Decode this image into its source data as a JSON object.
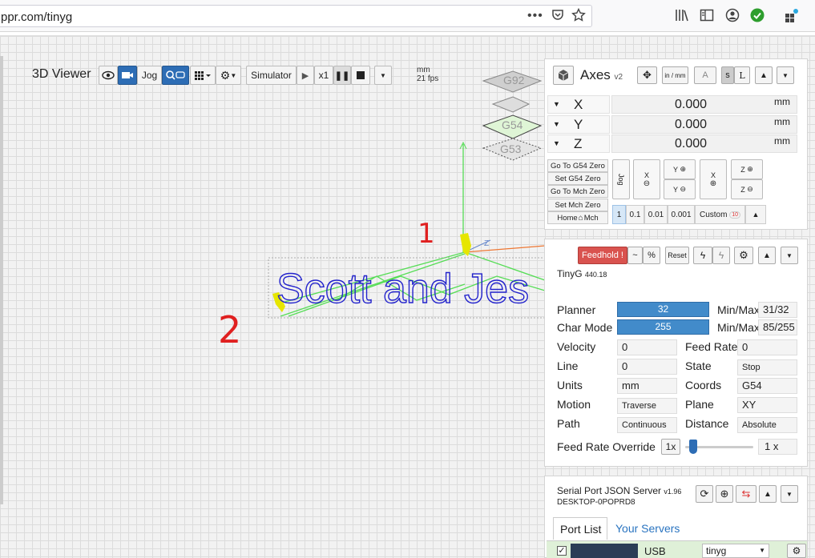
{
  "browser": {
    "url": "ppr.com/tinyg",
    "page_actions_icon": "ellipsis-icon",
    "pocket_icon": "pocket-icon",
    "bookmark_icon": "star-icon",
    "library_icon": "library-icon",
    "reader_icon": "sidebar-icon",
    "account_icon": "account-icon",
    "status_icon": "checkmark-icon",
    "extensions_icon": "extensions-icon"
  },
  "viewer": {
    "title": "3D Viewer",
    "jog_label": "Jog",
    "simulator_label": "Simulator",
    "speed_label": "x1",
    "units": "mm",
    "fps": "21 fps",
    "workspaces": [
      "G92",
      "G54",
      "G53"
    ],
    "canvas_text": "Scott and Jes",
    "annotation_1": "1",
    "annotation_2": "2"
  },
  "axes": {
    "title": "Axes",
    "version": "v2",
    "inmm_label": "in / mm",
    "s_label": "s",
    "l_label": "L",
    "rows": [
      {
        "name": "X",
        "value": "0.000",
        "unit": "mm"
      },
      {
        "name": "Y",
        "value": "0.000",
        "unit": "mm"
      },
      {
        "name": "Z",
        "value": "0.000",
        "unit": "mm"
      }
    ],
    "zero_buttons": [
      "Go To G54 Zero",
      "Set G54 Zero",
      "Go To Mch Zero",
      "Set Mch Zero",
      "Mch"
    ],
    "home_label": "Home",
    "jog_label": "Jog",
    "jog_x_minus": "X",
    "jog_x_plus": "X",
    "jog_y_plus": "Y",
    "jog_y_minus": "Y",
    "jog_z_plus": "Z",
    "jog_z_minus": "Z",
    "steps": [
      "1",
      "0.1",
      "0.01",
      "0.001"
    ],
    "custom_label": "Custom",
    "custom_value": "10"
  },
  "tinyg": {
    "feedhold_label": "Feedhold !",
    "tilde_label": "~",
    "percent_label": "%",
    "reset_label": "Reset",
    "name": "TinyG",
    "version": "440.18",
    "planner_label": "Planner",
    "planner_value": "32",
    "planner_fill": 1.0,
    "minmax_label": "Min/Max",
    "planner_minmax": "31/32",
    "charmode_label": "Char Mode",
    "charmode_value": "255",
    "charmode_fill": 1.0,
    "charmode_minmax": "85/255",
    "fields_left": [
      {
        "label": "Velocity",
        "value": "0"
      },
      {
        "label": "Line",
        "value": "0"
      },
      {
        "label": "Units",
        "value": "mm"
      },
      {
        "label": "Motion",
        "value": "Traverse"
      },
      {
        "label": "Path",
        "value": "Continuous"
      }
    ],
    "fields_right": [
      {
        "label": "Feed Rate",
        "value": "0"
      },
      {
        "label": "State",
        "value": "Stop"
      },
      {
        "label": "Coords",
        "value": "G54"
      },
      {
        "label": "Plane",
        "value": "XY"
      },
      {
        "label": "Distance",
        "value": "Absolute"
      }
    ],
    "override_label": "Feed Rate Override",
    "override_preset": "1x",
    "override_value": "1 x",
    "override_fraction": 0.05
  },
  "spjs": {
    "title": "Serial Port JSON Server",
    "version": "v1.96",
    "host": "DESKTOP-0POPRD8",
    "tabs": [
      "Port List",
      "Your Servers"
    ],
    "port_name": "USB",
    "port_type": "tinyg",
    "port_checked": true
  },
  "colors": {
    "accent": "#428bca",
    "feedhold": "#d9534f",
    "status_ok": "#2e9e2e",
    "text_path": "#2222cc",
    "toolpath": "#55dd55"
  }
}
